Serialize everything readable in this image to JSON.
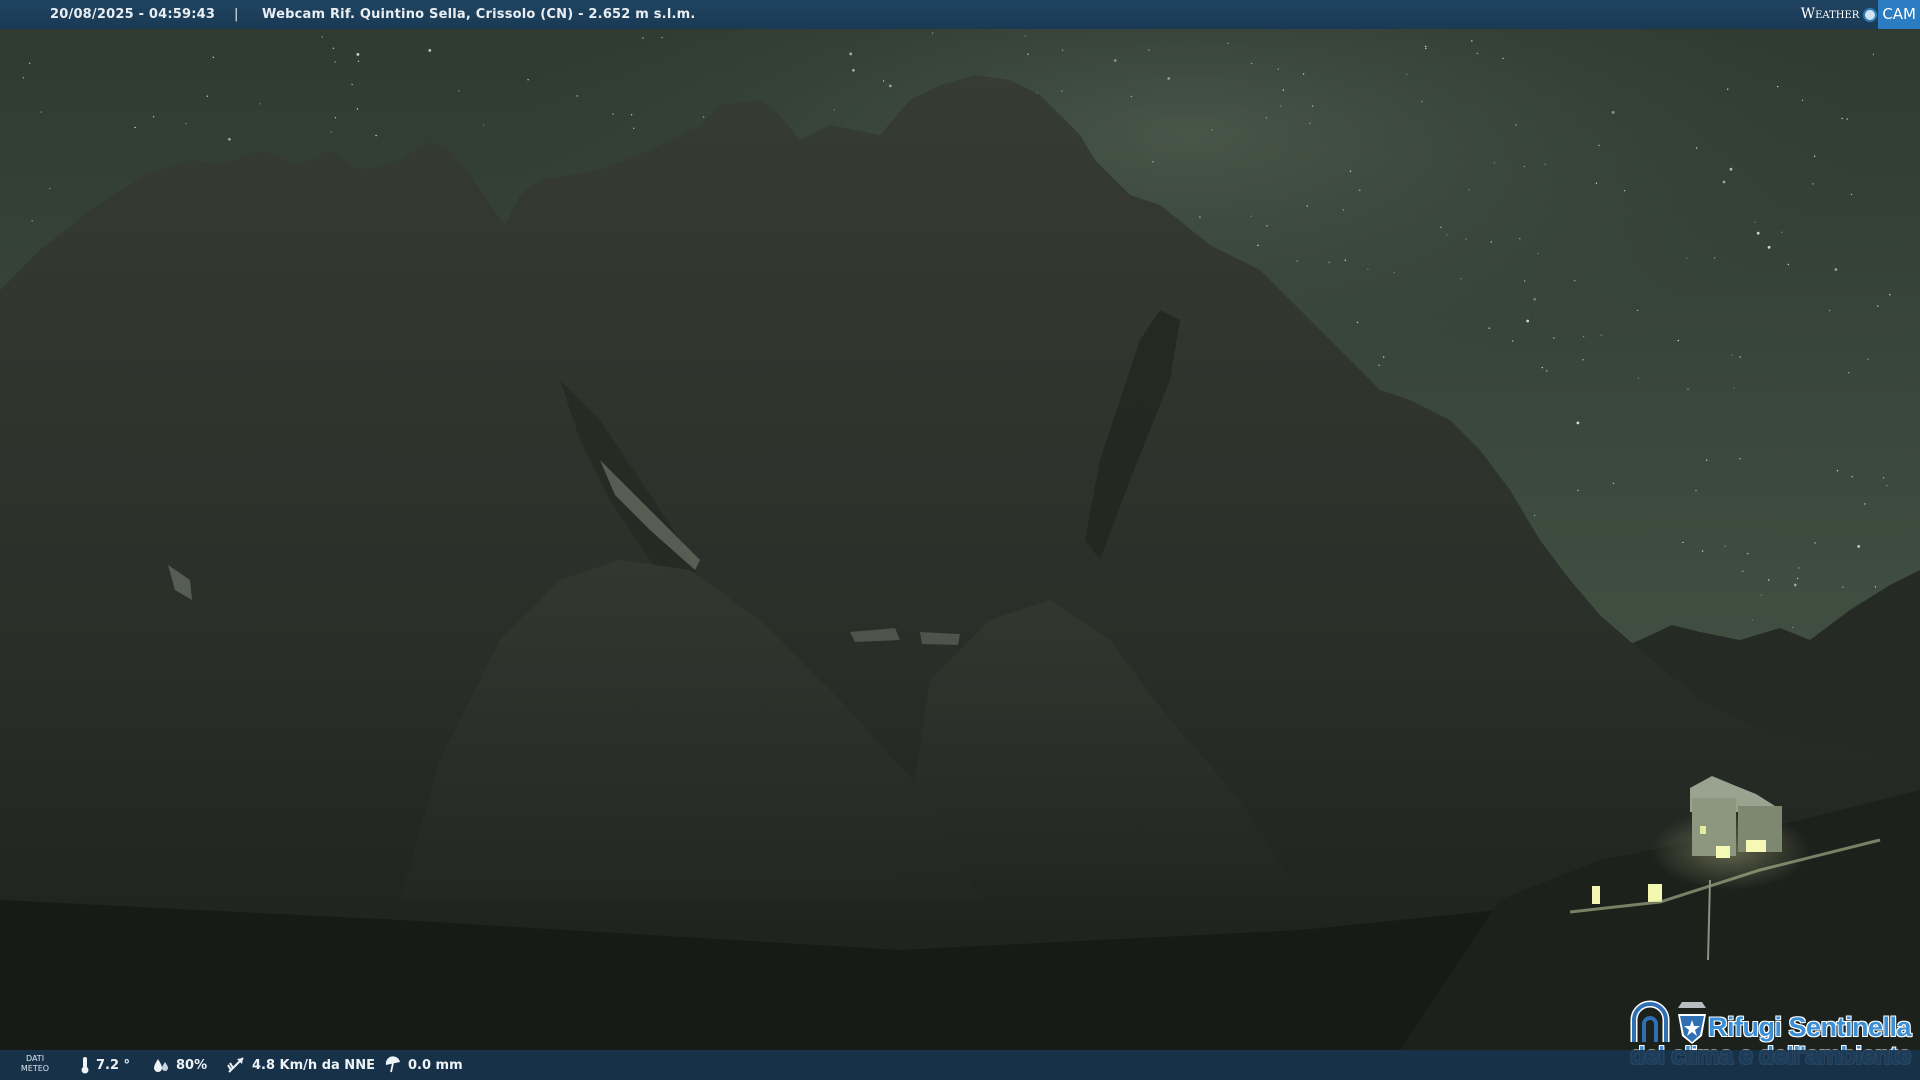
{
  "header": {
    "timestamp": "20/08/2025 - 04:59:43",
    "separator": "|",
    "title": "Webcam Rif. Quintino Sella, Crissolo (CN) - 2.652 m s.l.m.",
    "logo_weather": "Weather",
    "logo_cam": "CAM"
  },
  "weather": {
    "label": "DATI METEO",
    "temperature": "7.2 °",
    "humidity": "80%",
    "wind": "4.8 Km/h da NNE",
    "rain": "0.0 mm"
  },
  "logo": {
    "line1": "Rifugi Sentinella",
    "line2": "del clima e dell'ambiente"
  },
  "colors": {
    "bar": "#1e4260",
    "sky": "#3d4e3e",
    "mountain": "#2a2f28",
    "lights": "#f3f6a8",
    "logo_blue": "#3a8fd6"
  }
}
